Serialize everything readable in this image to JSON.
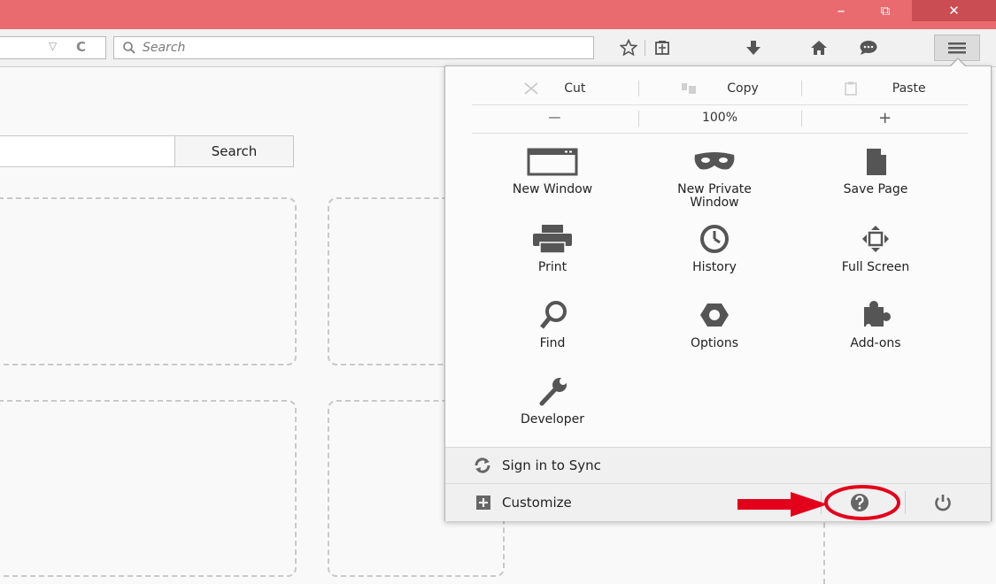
{
  "window": {
    "minimize_label": "–",
    "restore_label": "⧉",
    "close_label": "✕"
  },
  "toolbar": {
    "reload_glyph": "C",
    "dropdown_glyph": "▽",
    "search_placeholder": "Search"
  },
  "page": {
    "search_button_label": "Search"
  },
  "menu": {
    "edit": {
      "cut": "Cut",
      "copy": "Copy",
      "paste": "Paste"
    },
    "zoom": {
      "minus": "—",
      "value": "100%",
      "plus": "+"
    },
    "items": [
      {
        "label": "New Window",
        "icon": "new-window-icon"
      },
      {
        "label": "New Private Window",
        "icon": "private-window-icon"
      },
      {
        "label": "Save Page",
        "icon": "save-page-icon"
      },
      {
        "label": "Print",
        "icon": "print-icon"
      },
      {
        "label": "History",
        "icon": "history-icon"
      },
      {
        "label": "Full Screen",
        "icon": "full-screen-icon"
      },
      {
        "label": "Find",
        "icon": "find-icon"
      },
      {
        "label": "Options",
        "icon": "options-icon"
      },
      {
        "label": "Add-ons",
        "icon": "add-ons-icon"
      },
      {
        "label": "Developer",
        "icon": "developer-icon"
      }
    ],
    "sync_label": "Sign in to Sync",
    "customize_label": "Customize"
  },
  "colors": {
    "titlebar": "#e96b6f",
    "annotation_red": "#e3001b"
  }
}
